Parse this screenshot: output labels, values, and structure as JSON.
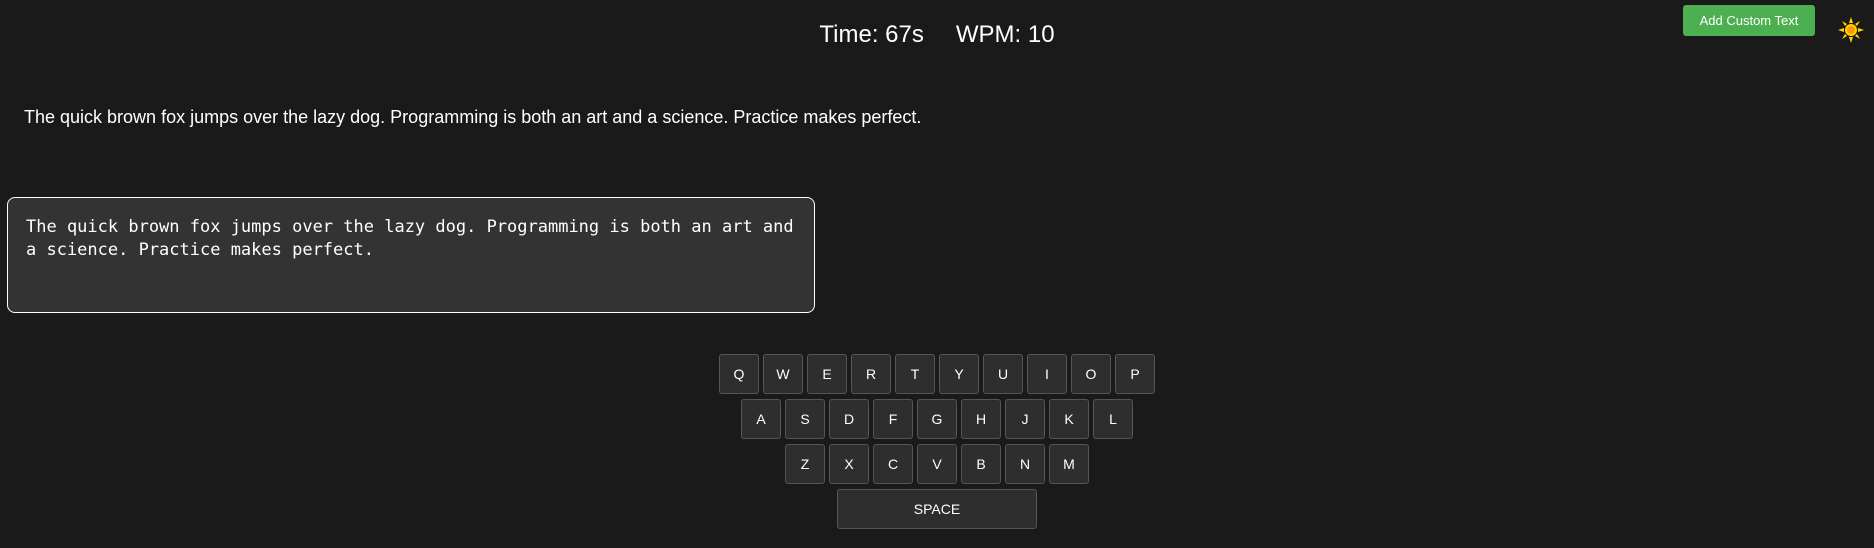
{
  "stats": {
    "time": "Time: 67s",
    "wpm": "WPM: 10"
  },
  "header": {
    "custom_button_label": "Add Custom Text",
    "theme_icon": "sun-icon",
    "theme_icon_color": "#ffd700"
  },
  "sample": {
    "text": "The quick brown fox jumps over the lazy dog. Programming is both an art and a science. Practice makes perfect."
  },
  "input": {
    "value": "The quick brown fox jumps over the lazy dog. Programming is both an art and a science. Practice makes perfect."
  },
  "keyboard": {
    "rows": [
      [
        "Q",
        "W",
        "E",
        "R",
        "T",
        "Y",
        "U",
        "I",
        "O",
        "P"
      ],
      [
        "A",
        "S",
        "D",
        "F",
        "G",
        "H",
        "J",
        "K",
        "L"
      ],
      [
        "Z",
        "X",
        "C",
        "V",
        "B",
        "N",
        "M"
      ]
    ],
    "space_label": "SPACE"
  },
  "colors": {
    "background": "#1a1a1a",
    "accent": "#4caf50",
    "input_bg": "#333333",
    "key_bg": "#2e2e2e"
  }
}
